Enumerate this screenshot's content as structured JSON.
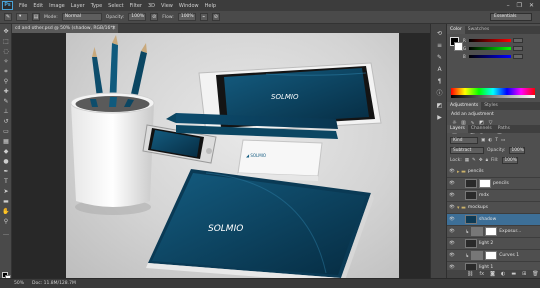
{
  "menubar": {
    "logo": "Ps",
    "items": [
      "File",
      "Edit",
      "Image",
      "Layer",
      "Type",
      "Select",
      "Filter",
      "3D",
      "View",
      "Window",
      "Help"
    ],
    "controls": [
      "–",
      "❐",
      "✕"
    ]
  },
  "options": {
    "mode_label": "Mode:",
    "mode_value": "Normal",
    "opacity_label": "Opacity:",
    "opacity_value": "100%",
    "flow_label": "Flow:",
    "flow_value": "100%",
    "workspace": "Essentials"
  },
  "document": {
    "tab_title": "cd and other.psd @ 50% (shadow, RGB/16*)",
    "close": "×"
  },
  "status": {
    "zoom": "50%",
    "doc_info": "Doc: 11.8M/128.7M"
  },
  "panels": {
    "color_tabs": [
      "Color",
      "Swatches"
    ],
    "adjust_tabs": [
      "Adjustments",
      "Styles"
    ],
    "adjust_title": "Add an adjustment",
    "layers_tabs": [
      "Layers",
      "Channels",
      "Paths"
    ],
    "kind_label": "Kind",
    "blend_value": "Subtract",
    "opacity_label": "Opacity:",
    "opacity_value": "100%",
    "lock_label": "Lock:",
    "fill_label": "Fill:",
    "fill_value": "100%",
    "sliders": [
      "R",
      "G",
      "B"
    ],
    "layers": [
      {
        "name": "pencils",
        "type": "group"
      },
      {
        "name": "pencils",
        "type": "layer"
      },
      {
        "name": "mdx",
        "type": "layer"
      },
      {
        "name": "mockups",
        "type": "group"
      },
      {
        "name": "shadow",
        "type": "layer"
      },
      {
        "name": "Exposur...",
        "type": "adjustment"
      },
      {
        "name": "light 2",
        "type": "layer"
      },
      {
        "name": "Curves 1",
        "type": "adjustment"
      },
      {
        "name": "light 1",
        "type": "layer"
      }
    ]
  },
  "colors": {
    "accent": "#3d6f97",
    "brand_teal": "#0d4f6e",
    "canvas_bg": "#d8d8d8"
  }
}
